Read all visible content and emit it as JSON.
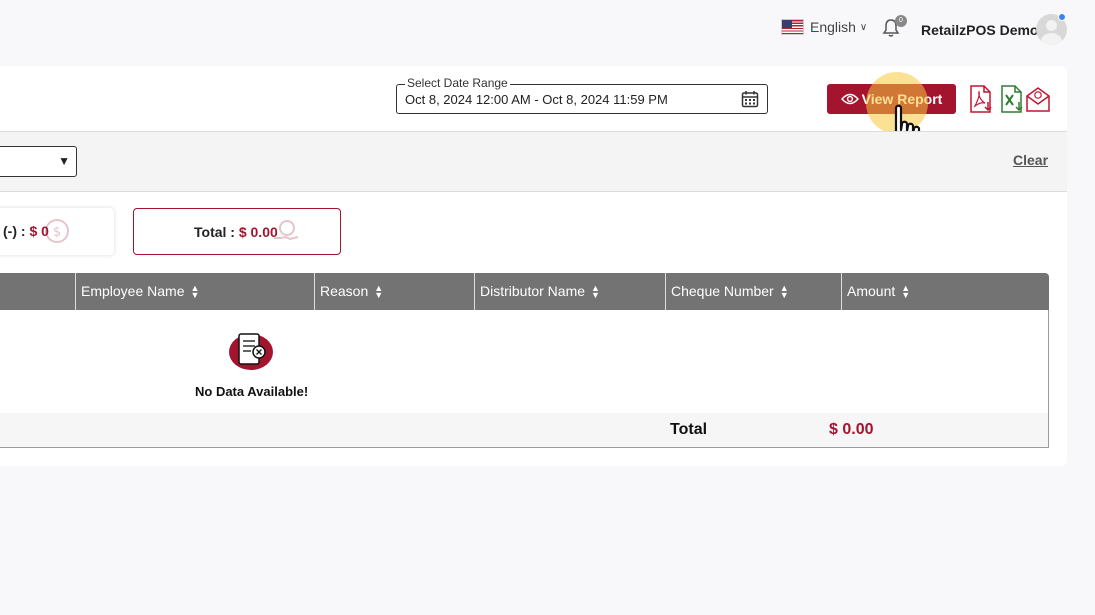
{
  "header": {
    "language": "English",
    "notification_count": "0",
    "username": "RetailzPOS Demo"
  },
  "report": {
    "date_range_label": "Select Date Range",
    "date_range_value": "Oct 8, 2024 12:00 AM - Oct 8, 2024 11:59 PM",
    "view_report_label": "View Report",
    "export_icons": [
      "pdf-export-icon",
      "excel-export-icon",
      "email-export-icon"
    ],
    "clear_label": "Clear"
  },
  "summary": {
    "card1_label": "(-) : ",
    "card1_value": "$ 0",
    "card2_label": "Total : ",
    "card2_value": "$ 0.00"
  },
  "table": {
    "columns": [
      "Employee Name",
      "Reason",
      "Distributor Name",
      "Cheque Number",
      "Amount"
    ],
    "empty_message": "No Data Available!",
    "footer_label": "Total",
    "footer_value": "$ 0.00"
  },
  "colors": {
    "accent": "#a3152f",
    "table_header": "#737373"
  }
}
